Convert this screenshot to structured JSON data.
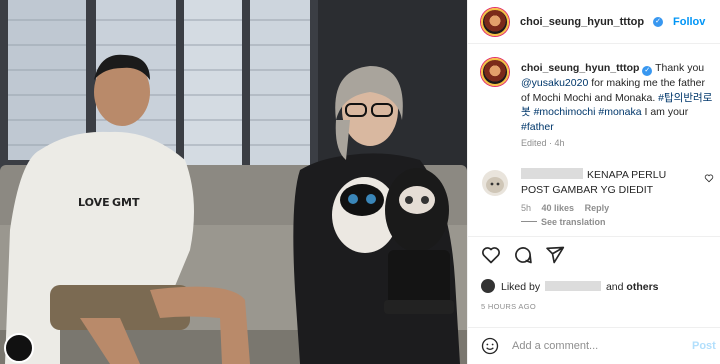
{
  "post": {
    "photo_alt": "",
    "username": "choi_seung_hyun_tttop",
    "follow_label": "Follov"
  },
  "caption": {
    "username": "choi_seung_hyun_tttop",
    "text_1": "Thank you",
    "mention": "@yusaku2020",
    "text_2": "for making me the father of Mochi Mochi and Monaka.",
    "hashtag_1": "#탑의반려로봇",
    "hashtag_2": "#mochimochi",
    "hashtag_3": "#monaka",
    "text_3": "I am your",
    "hashtag_4": "#father",
    "edited": "Edited · 4h"
  },
  "comment": {
    "text": "KENAPA PERLU POST GAMBAR YG DIEDIT",
    "age": "5h",
    "likes": "40 likes",
    "reply": "Reply",
    "see_translation": "See translation"
  },
  "likes": {
    "prefix": "Liked by",
    "connector": "and",
    "others": "others"
  },
  "timestamp": "5 HOURS AGO",
  "add_comment": {
    "placeholder": "Add a comment...",
    "post_label": "Post"
  },
  "icons": {
    "like": "heart-icon",
    "comment": "comment-icon",
    "share": "share-icon",
    "emoji": "emoji-icon",
    "verified": "verified-badge-icon"
  },
  "colors": {
    "link": "#00376b",
    "follow": "#0095f6",
    "verified": "#3897f0",
    "post_disabled": "#b2dffc",
    "muted": "#8e8e8e"
  }
}
